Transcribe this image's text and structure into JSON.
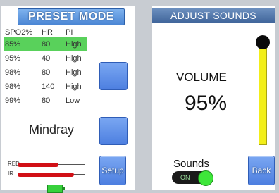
{
  "preset": {
    "title": "PRESET MODE",
    "columns": {
      "spo2": "SPO2%",
      "hr": "HR",
      "pi": "PI"
    },
    "rows": [
      {
        "spo2": "85%",
        "hr": "80",
        "pi": "High",
        "selected": true
      },
      {
        "spo2": "95%",
        "hr": "40",
        "pi": "High"
      },
      {
        "spo2": "98%",
        "hr": "80",
        "pi": "High"
      },
      {
        "spo2": "98%",
        "hr": "140",
        "pi": "High"
      },
      {
        "spo2": "99%",
        "hr": "80",
        "pi": "Low"
      }
    ],
    "device": "Mindray",
    "waveforms": {
      "red": "RED",
      "ir": "IR"
    },
    "setup_label": "Setup"
  },
  "sounds": {
    "title": "ADJUST SOUNDS",
    "volume_label": "VOLUME",
    "volume_value": "95%",
    "volume_level": 0.95,
    "sounds_label": "Sounds",
    "toggle_state": "ON",
    "back_label": "Back"
  },
  "colors": {
    "header_blue": "#4b86d4",
    "selected_green": "#59d15b",
    "slider_yellow": "#f2ee19",
    "wave_red": "#d10f16",
    "toggle_green": "#3ee63a"
  }
}
